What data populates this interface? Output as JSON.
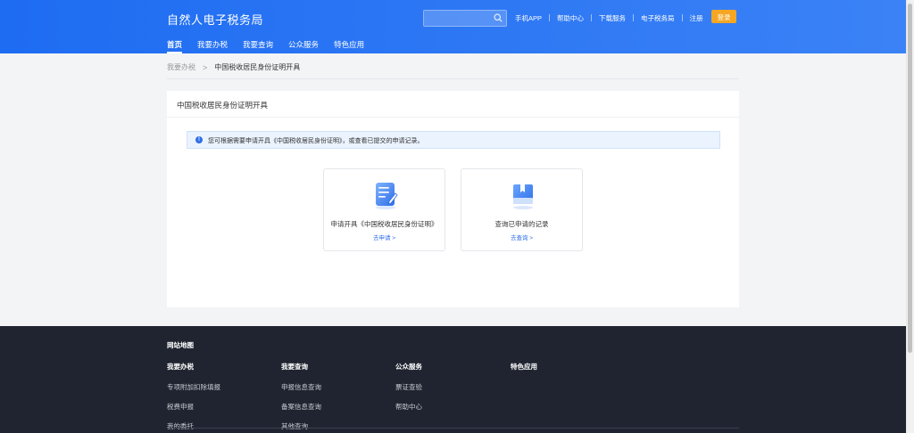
{
  "header": {
    "brand": "自然人电子税务局",
    "search": {
      "placeholder": ""
    },
    "links": [
      "手机APP",
      "帮助中心",
      "下载服务",
      "电子税务局",
      "注册"
    ],
    "login_label": "登录",
    "nav": [
      "首页",
      "我要办税",
      "我要查询",
      "公众服务",
      "特色应用"
    ]
  },
  "breadcrumb": {
    "parent": "我要办税",
    "separator": ">",
    "current": "中国税收居民身份证明开具"
  },
  "card": {
    "title": "中国税收居民身份证明开具",
    "notice": "您可根据需要申请开具《中国税收居民身份证明》，或查看已提交的申请记录。",
    "tiles": [
      {
        "label": "申请开具《中国税收居民身份证明》",
        "link": "去申请 >"
      },
      {
        "label": "查询已申请的记录",
        "link": "去查询 >"
      }
    ]
  },
  "footer": {
    "title": "网站地图",
    "columns": [
      {
        "heading": "我要办税",
        "links": [
          "专项附加扣除填报",
          "税费申报",
          "我的委托"
        ]
      },
      {
        "heading": "我要查询",
        "links": [
          "申报信息查询",
          "备案信息查询",
          "其他查询"
        ]
      },
      {
        "heading": "公众服务",
        "links": [
          "票证查验",
          "帮助中心"
        ]
      },
      {
        "heading": "特色应用",
        "links": []
      }
    ]
  },
  "colors": {
    "header_start": "#1e6cf2",
    "header_end": "#3b82f6",
    "login": "#f5a623",
    "accent": "#2f6fe6",
    "footer_bg": "#1f2430"
  }
}
